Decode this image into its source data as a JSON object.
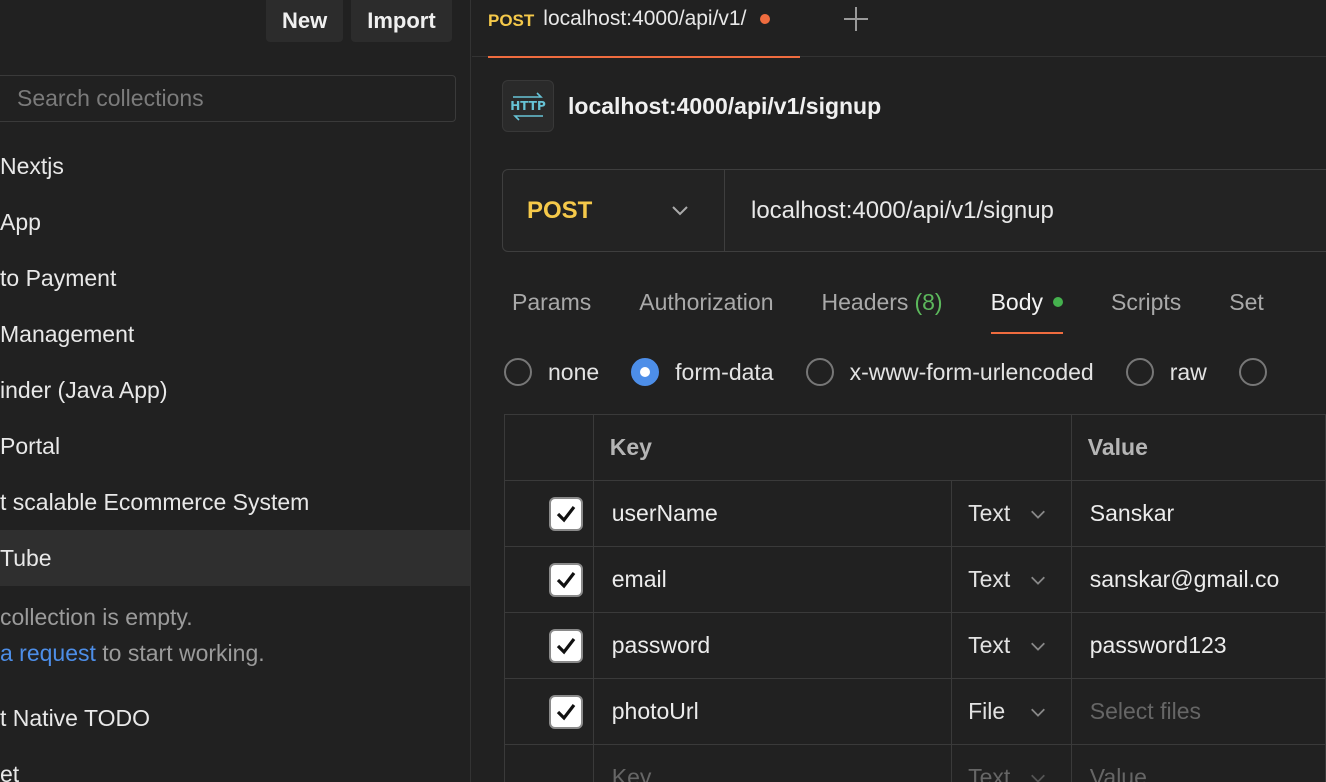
{
  "sidebar": {
    "new_label": "New",
    "import_label": "Import",
    "search_placeholder": "Search collections",
    "collections": [
      {
        "label": " Nextjs"
      },
      {
        "label": "App"
      },
      {
        "label": "to Payment"
      },
      {
        "label": "Management"
      },
      {
        "label": "inder (Java App)"
      },
      {
        "label": "Portal"
      },
      {
        "label": "t scalable Ecommerce System"
      },
      {
        "label": "Tube"
      }
    ],
    "empty_line1": "collection is empty.",
    "empty_link": "a request",
    "empty_line2_rest": " to start working.",
    "after_items": [
      {
        "label": "t Native TODO"
      },
      {
        "label": "et"
      }
    ]
  },
  "tab": {
    "method": "POST",
    "url": "localhost:4000/api/v1/"
  },
  "request": {
    "title": "localhost:4000/api/v1/signup",
    "method": "POST",
    "url": "localhost:4000/api/v1/signup"
  },
  "request_tabs": {
    "params": "Params",
    "authorization": "Authorization",
    "headers": "Headers",
    "headers_count": "(8)",
    "body": "Body",
    "scripts": "Scripts",
    "settings": "Set"
  },
  "body_types": {
    "none": "none",
    "form_data": "form-data",
    "urlencoded": "x-www-form-urlencoded",
    "raw": "raw"
  },
  "table": {
    "key_header": "Key",
    "value_header": "Value",
    "rows": [
      {
        "key": "userName",
        "type": "Text",
        "value": "Sanskar"
      },
      {
        "key": "email",
        "type": "Text",
        "value": "sanskar@gmail.co"
      },
      {
        "key": "password",
        "type": "Text",
        "value": "password123"
      },
      {
        "key": "photoUrl",
        "type": "File",
        "value": "Select files"
      }
    ],
    "placeholder_key": "Key",
    "placeholder_type": "Text",
    "placeholder_value": "Value"
  },
  "colors": {
    "accent": "#ef6c3f",
    "method": "#f5c94a",
    "link": "#4d8ee8",
    "ok": "#45b14e"
  }
}
